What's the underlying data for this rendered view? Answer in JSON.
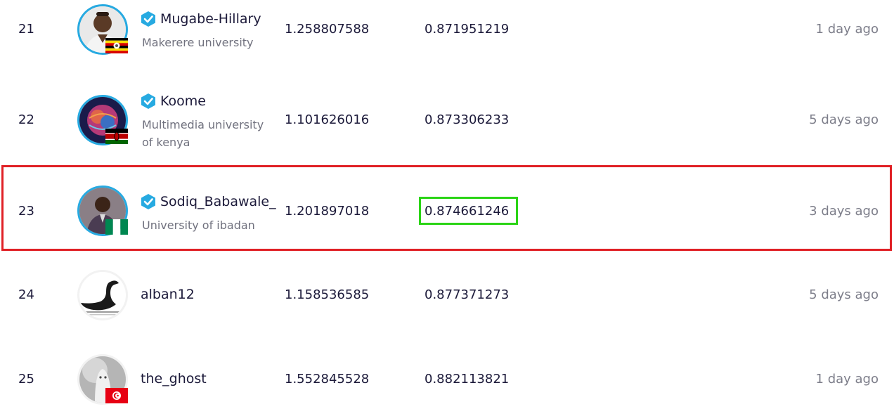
{
  "rows": [
    {
      "rank": "21",
      "name": "Mugabe-Hillary",
      "org": "Makerere university",
      "score1": "1.258807588",
      "score2": "0.871951219",
      "time": "1 day ago",
      "verified": true,
      "flag": "uganda"
    },
    {
      "rank": "22",
      "name": "Koome",
      "org": "Multimedia university of kenya",
      "score1": "1.101626016",
      "score2": "0.873306233",
      "time": "5 days ago",
      "verified": true,
      "flag": "kenya"
    },
    {
      "rank": "23",
      "name": "Sodiq_Babawale_",
      "org": "University of ibadan",
      "score1": "1.201897018",
      "score2": "0.874661246",
      "time": "3 days ago",
      "verified": true,
      "flag": "nigeria"
    },
    {
      "rank": "24",
      "name": "alban12",
      "org": "",
      "score1": "1.158536585",
      "score2": "0.877371273",
      "time": "5 days ago",
      "verified": false,
      "flag": ""
    },
    {
      "rank": "25",
      "name": "the_ghost",
      "org": "",
      "score1": "1.552845528",
      "score2": "0.882113821",
      "time": "1 day ago",
      "verified": false,
      "flag": "tunisia"
    }
  ],
  "colors": {
    "text": "#1c1a3a",
    "muted": "#70717e",
    "verified": "#27aae1",
    "highlight_row": "#e02025",
    "highlight_cell": "#2bd416"
  }
}
